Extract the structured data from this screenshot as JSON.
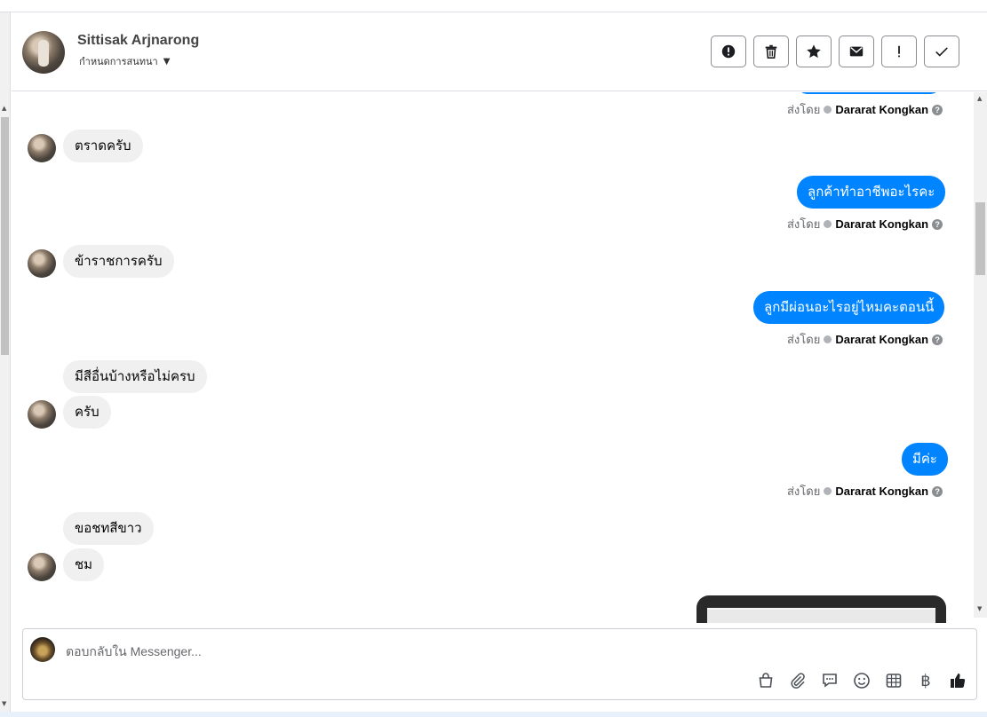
{
  "header": {
    "name": "Sittisak Arjnarong",
    "assign_label": "กำหนดการสนทนา",
    "actions": [
      {
        "name": "spam-alert-button",
        "icon": "alert-circle-icon"
      },
      {
        "name": "delete-button",
        "icon": "trash-icon"
      },
      {
        "name": "star-button",
        "icon": "star-icon"
      },
      {
        "name": "mark-unread-button",
        "icon": "envelope-icon"
      },
      {
        "name": "follow-up-button",
        "icon": "exclamation-icon"
      },
      {
        "name": "mark-done-button",
        "icon": "check-icon"
      }
    ]
  },
  "chat": {
    "sent_prefix": "ส่งโดย",
    "agent_name": "Dararat Kongkan",
    "messages": {
      "m1": "ตราดครับ",
      "m2": "ลูกค้าทำอาชีพอะไรคะ",
      "m3": "ข้าราชการครับ",
      "m4": "ลูกมีผ่อนอะไรอยู่ไหมคะตอนนี้",
      "m5": "มีสีอื่นบ้างหรือไม่ครบ",
      "m6": "ครับ",
      "m7": "มีค่ะ",
      "m8": "ขอชทสีขาว",
      "m9": "ชม"
    }
  },
  "composer": {
    "placeholder": "ตอบกลับใน Messenger...",
    "tools": [
      "bag-icon",
      "paperclip-icon",
      "speech-bubble-icon",
      "smiley-icon",
      "table-icon",
      "baht-icon",
      "thumbs-up-icon"
    ]
  },
  "colors": {
    "outgoing_bubble": "#0084ff",
    "incoming_bubble": "#f0f0f0",
    "secondary_text": "#65676b"
  }
}
